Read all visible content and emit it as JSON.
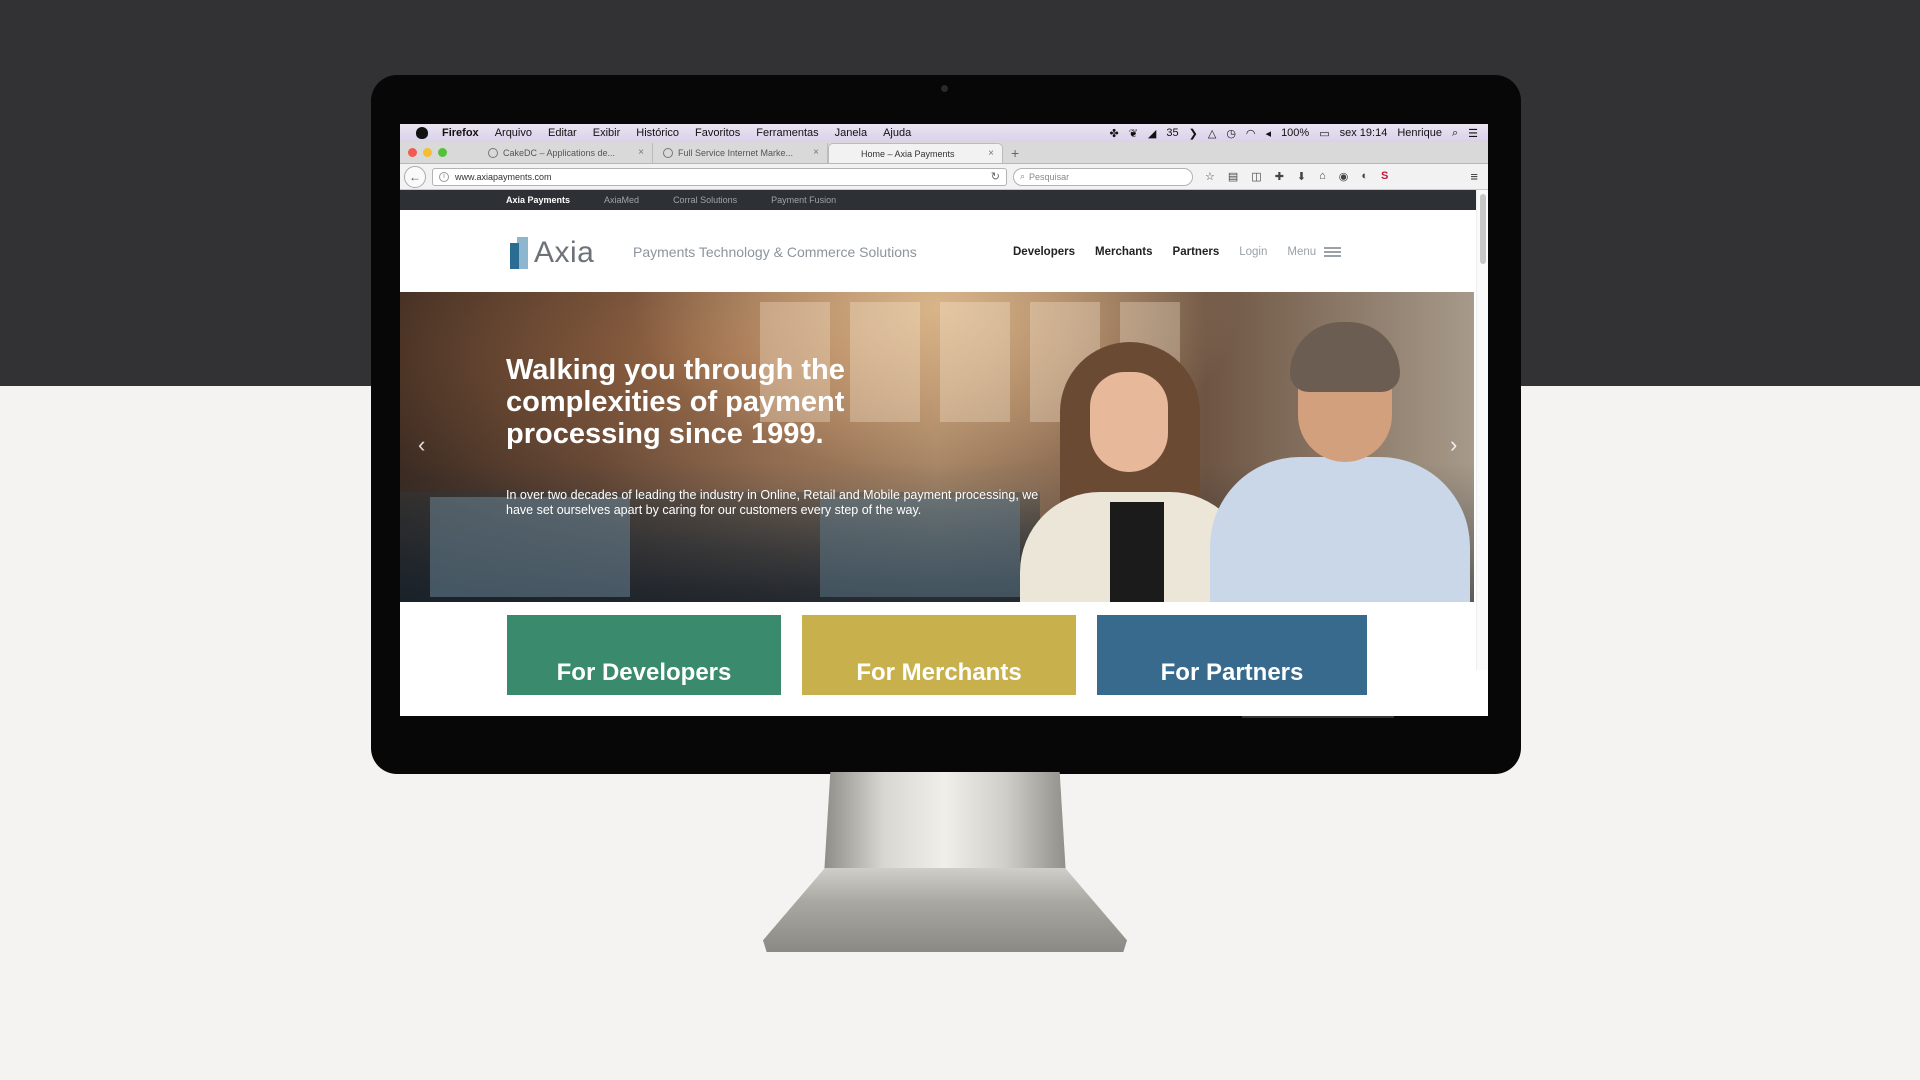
{
  "macos_menubar": {
    "app": "Firefox",
    "menus": [
      "Arquivo",
      "Editar",
      "Exibir",
      "Histórico",
      "Favoritos",
      "Ferramentas",
      "Janela",
      "Ajuda"
    ],
    "status_count": "35",
    "battery": "100%",
    "clock": "sex 19:14",
    "user": "Henrique"
  },
  "browser": {
    "tabs": [
      {
        "label": "CakeDC – Applications de...",
        "active": false
      },
      {
        "label": "Full Service Internet Marke...",
        "active": false
      },
      {
        "label": "Home – Axia Payments",
        "active": true
      }
    ],
    "new_tab": "+",
    "url": "www.axiapayments.com",
    "search_placeholder": "Pesquisar"
  },
  "site": {
    "topstrip": [
      "Axia Payments",
      "AxiaMed",
      "Corral Solutions",
      "Payment Fusion"
    ],
    "logo": "Axia",
    "tagline": "Payments Technology & Commerce Solutions",
    "nav": {
      "developers": "Developers",
      "merchants": "Merchants",
      "partners": "Partners",
      "login": "Login",
      "menu": "Menu"
    },
    "hero": {
      "title": "Walking you through the complexities of payment processing since 1999.",
      "text": "In over two decades of leading the industry in Online, Retail and Mobile payment processing, we have set ourselves apart by caring for our customers every step of the way.",
      "prev": "‹",
      "next": "›"
    },
    "cards": {
      "developers": "For Developers",
      "merchants": "For Merchants",
      "partners": "For Partners"
    }
  }
}
